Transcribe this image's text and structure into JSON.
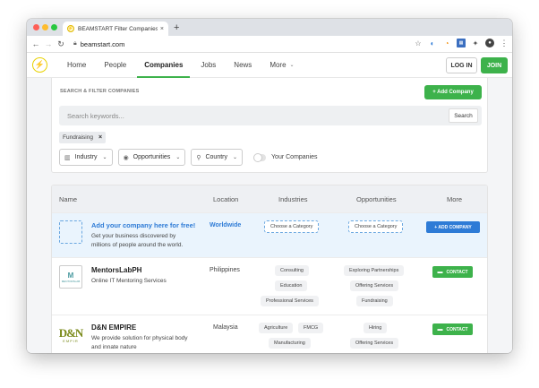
{
  "browser": {
    "tab_title": "BEAMSTART Filter Companies",
    "tab_close": "×",
    "new_tab": "+",
    "url": "beamstart.com"
  },
  "site": {
    "logo_glyph": "⚡",
    "nav": [
      {
        "label": "Home"
      },
      {
        "label": "People"
      },
      {
        "label": "Companies"
      },
      {
        "label": "Jobs"
      },
      {
        "label": "News"
      },
      {
        "label": "More"
      }
    ],
    "login": "LOG IN",
    "join": "JOIN",
    "brand_green": "#3db24b",
    "brand_blue": "#2e7bd6"
  },
  "filter": {
    "title": "SEARCH & FILTER COMPANIES",
    "add_company": "+ Add Company",
    "search_placeholder": "Search keywords...",
    "search_button": "Search",
    "active_chip": "Fundraising",
    "chip_remove": "×",
    "industry": "Industry",
    "opportunities": "Opportunities",
    "country": "Country",
    "your_companies": "Your Companies"
  },
  "table": {
    "headers": {
      "name": "Name",
      "location": "Location",
      "industries": "Industries",
      "opportunities": "Opportunities",
      "more": "More"
    },
    "promo": {
      "title": "Add your company here for free!",
      "desc_line1": "Get your business discovered by",
      "desc_line2": "millions of people around the world.",
      "location": "Worldwide",
      "industry": "Choose a Category",
      "opportunity": "Choose a Category",
      "button": "+ ADD COMPANY"
    },
    "rows": [
      {
        "name": "MentorsLabPH",
        "desc_line1": "Online IT Mentoring Services",
        "desc_line2": "",
        "location": "Philippines",
        "industries": [
          "Consulting",
          "Education",
          "Professional Services"
        ],
        "opportunities": [
          "Exploring Partnerships",
          "Offering Services",
          "Fundraising"
        ],
        "button": "CONTACT",
        "logo_text": "M",
        "logo_sub": "MENTORSLAB"
      },
      {
        "name": "D&N EMPIRE",
        "desc_line1": "We provide solution for physical body",
        "desc_line2": "and innate nature",
        "location": "Malaysia",
        "industries": [
          "Agriculture",
          "FMCG",
          "Manufacturing"
        ],
        "opportunities": [
          "Hiring",
          "Offering Services"
        ],
        "button": "CONTACT",
        "logo_text": "D&N",
        "logo_sub": "EMPIR"
      }
    ]
  }
}
